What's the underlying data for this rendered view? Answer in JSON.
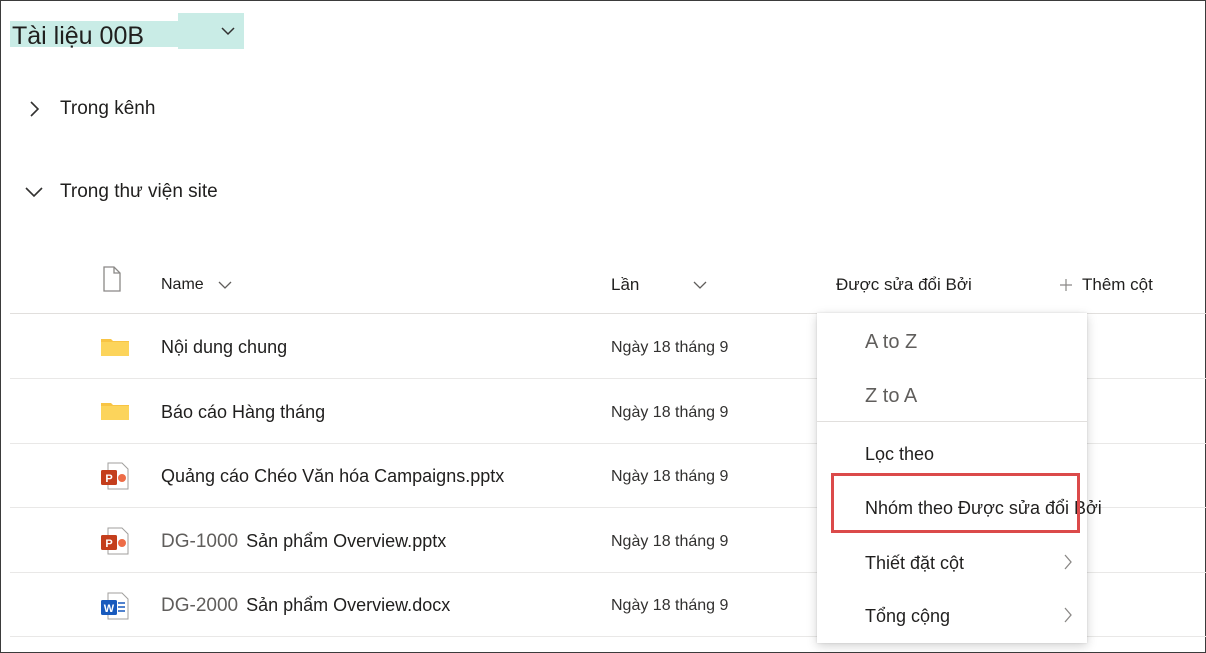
{
  "library": {
    "title": "Tài liệu 00B",
    "title_dropdown_icon": "chevron-down-icon"
  },
  "sections": [
    {
      "label": "Trong kênh",
      "state": "collapsed",
      "icon": "chevron-right-icon"
    },
    {
      "label": "Trong thư viện site",
      "state": "expanded",
      "icon": "chevron-down-icon"
    }
  ],
  "columns": {
    "file_type_icon": "document-icon",
    "name": "Name",
    "modified": "Lần",
    "modified_by": "Được sửa đổi Bởi",
    "add_column": "Thêm cột",
    "add_column_icon": "plus-icon"
  },
  "rows": [
    {
      "type": "folder",
      "icon": "folder-icon",
      "prefix": "",
      "name": "Nội dung chung",
      "date": "Ngày 18 tháng 9"
    },
    {
      "type": "folder",
      "icon": "folder-icon",
      "prefix": "",
      "name": "Báo cáo Hàng tháng",
      "date": "Ngày 18 tháng 9"
    },
    {
      "type": "pptx",
      "icon": "powerpoint-icon",
      "prefix": "",
      "name": "Quảng cáo Chéo Văn hóa Campaigns.pptx",
      "date": "Ngày 18 tháng 9"
    },
    {
      "type": "pptx",
      "icon": "powerpoint-icon",
      "prefix": "DG-1000",
      "name": "Sản phẩm Overview.pptx",
      "date": "Ngày 18 tháng 9"
    },
    {
      "type": "docx",
      "icon": "word-icon",
      "prefix": "DG-2000",
      "name": "Sản phẩm Overview.docx",
      "date": "Ngày 18 tháng 9"
    }
  ],
  "column_menu": {
    "items": [
      {
        "label": "A to Z",
        "kind": "sort"
      },
      {
        "label": "Z to A",
        "kind": "sort"
      },
      {
        "label": "Lọc theo",
        "kind": "action"
      },
      {
        "label": "Nhóm theo Được sửa đổi Bởi",
        "kind": "action",
        "highlighted": true
      },
      {
        "label": "Thiết đặt cột",
        "kind": "submenu",
        "icon": "chevron-right-icon"
      },
      {
        "label": "Tổng cộng",
        "kind": "submenu",
        "icon": "chevron-right-icon"
      }
    ],
    "highlight_color": "#db4a4a"
  },
  "colors": {
    "title_highlight": "#c9ece6",
    "folder": "#f8c444",
    "powerpoint": "#c43e1c",
    "word": "#185abd"
  }
}
